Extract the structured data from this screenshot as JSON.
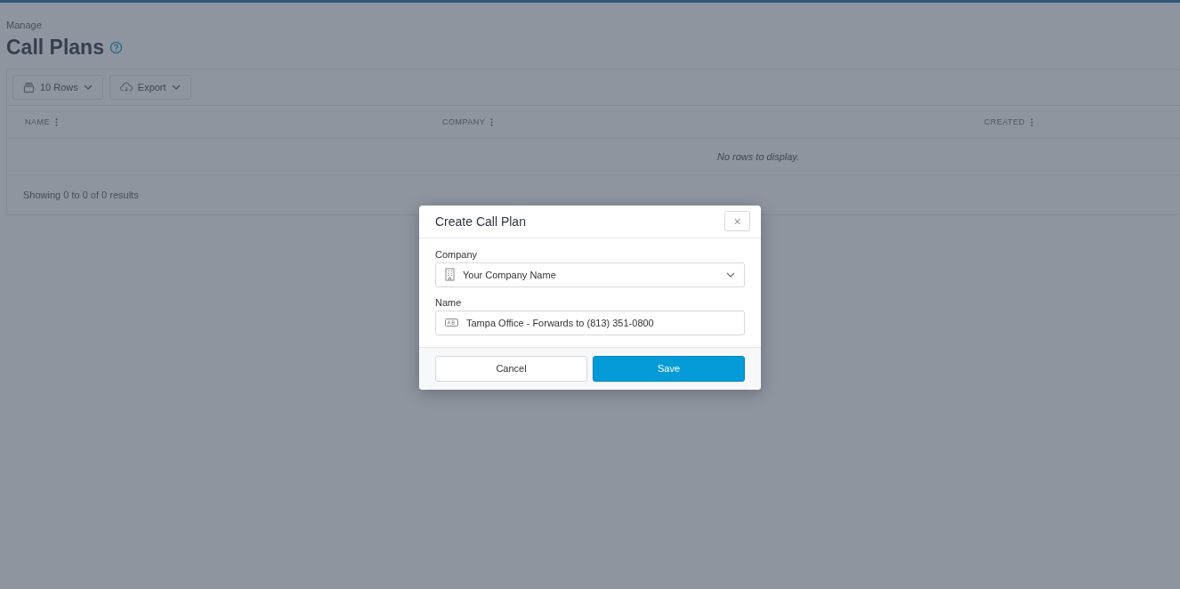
{
  "breadcrumb": "Manage",
  "page_title": "Call Plans",
  "toolbar": [
    {
      "label": "10 Rows",
      "kind": "rows"
    },
    {
      "label": "Export",
      "kind": "export"
    }
  ],
  "table": {
    "columns": [
      "NAME",
      "COMPANY",
      "CREATED"
    ],
    "empty_message": "No rows to display.",
    "footer": "Showing 0 to 0 of 0 results"
  },
  "dialog": {
    "title": "Create Call Plan",
    "close": "×",
    "fields": [
      {
        "label": "Company",
        "kind": "select",
        "value": "Your Company Name"
      },
      {
        "label": "Name",
        "kind": "text",
        "value": "Tampa Office - Forwards to (813) 351-0800"
      }
    ],
    "buttons": [
      {
        "label": "Cancel",
        "kind": "secondary"
      },
      {
        "label": "Save",
        "kind": "primary"
      }
    ]
  }
}
